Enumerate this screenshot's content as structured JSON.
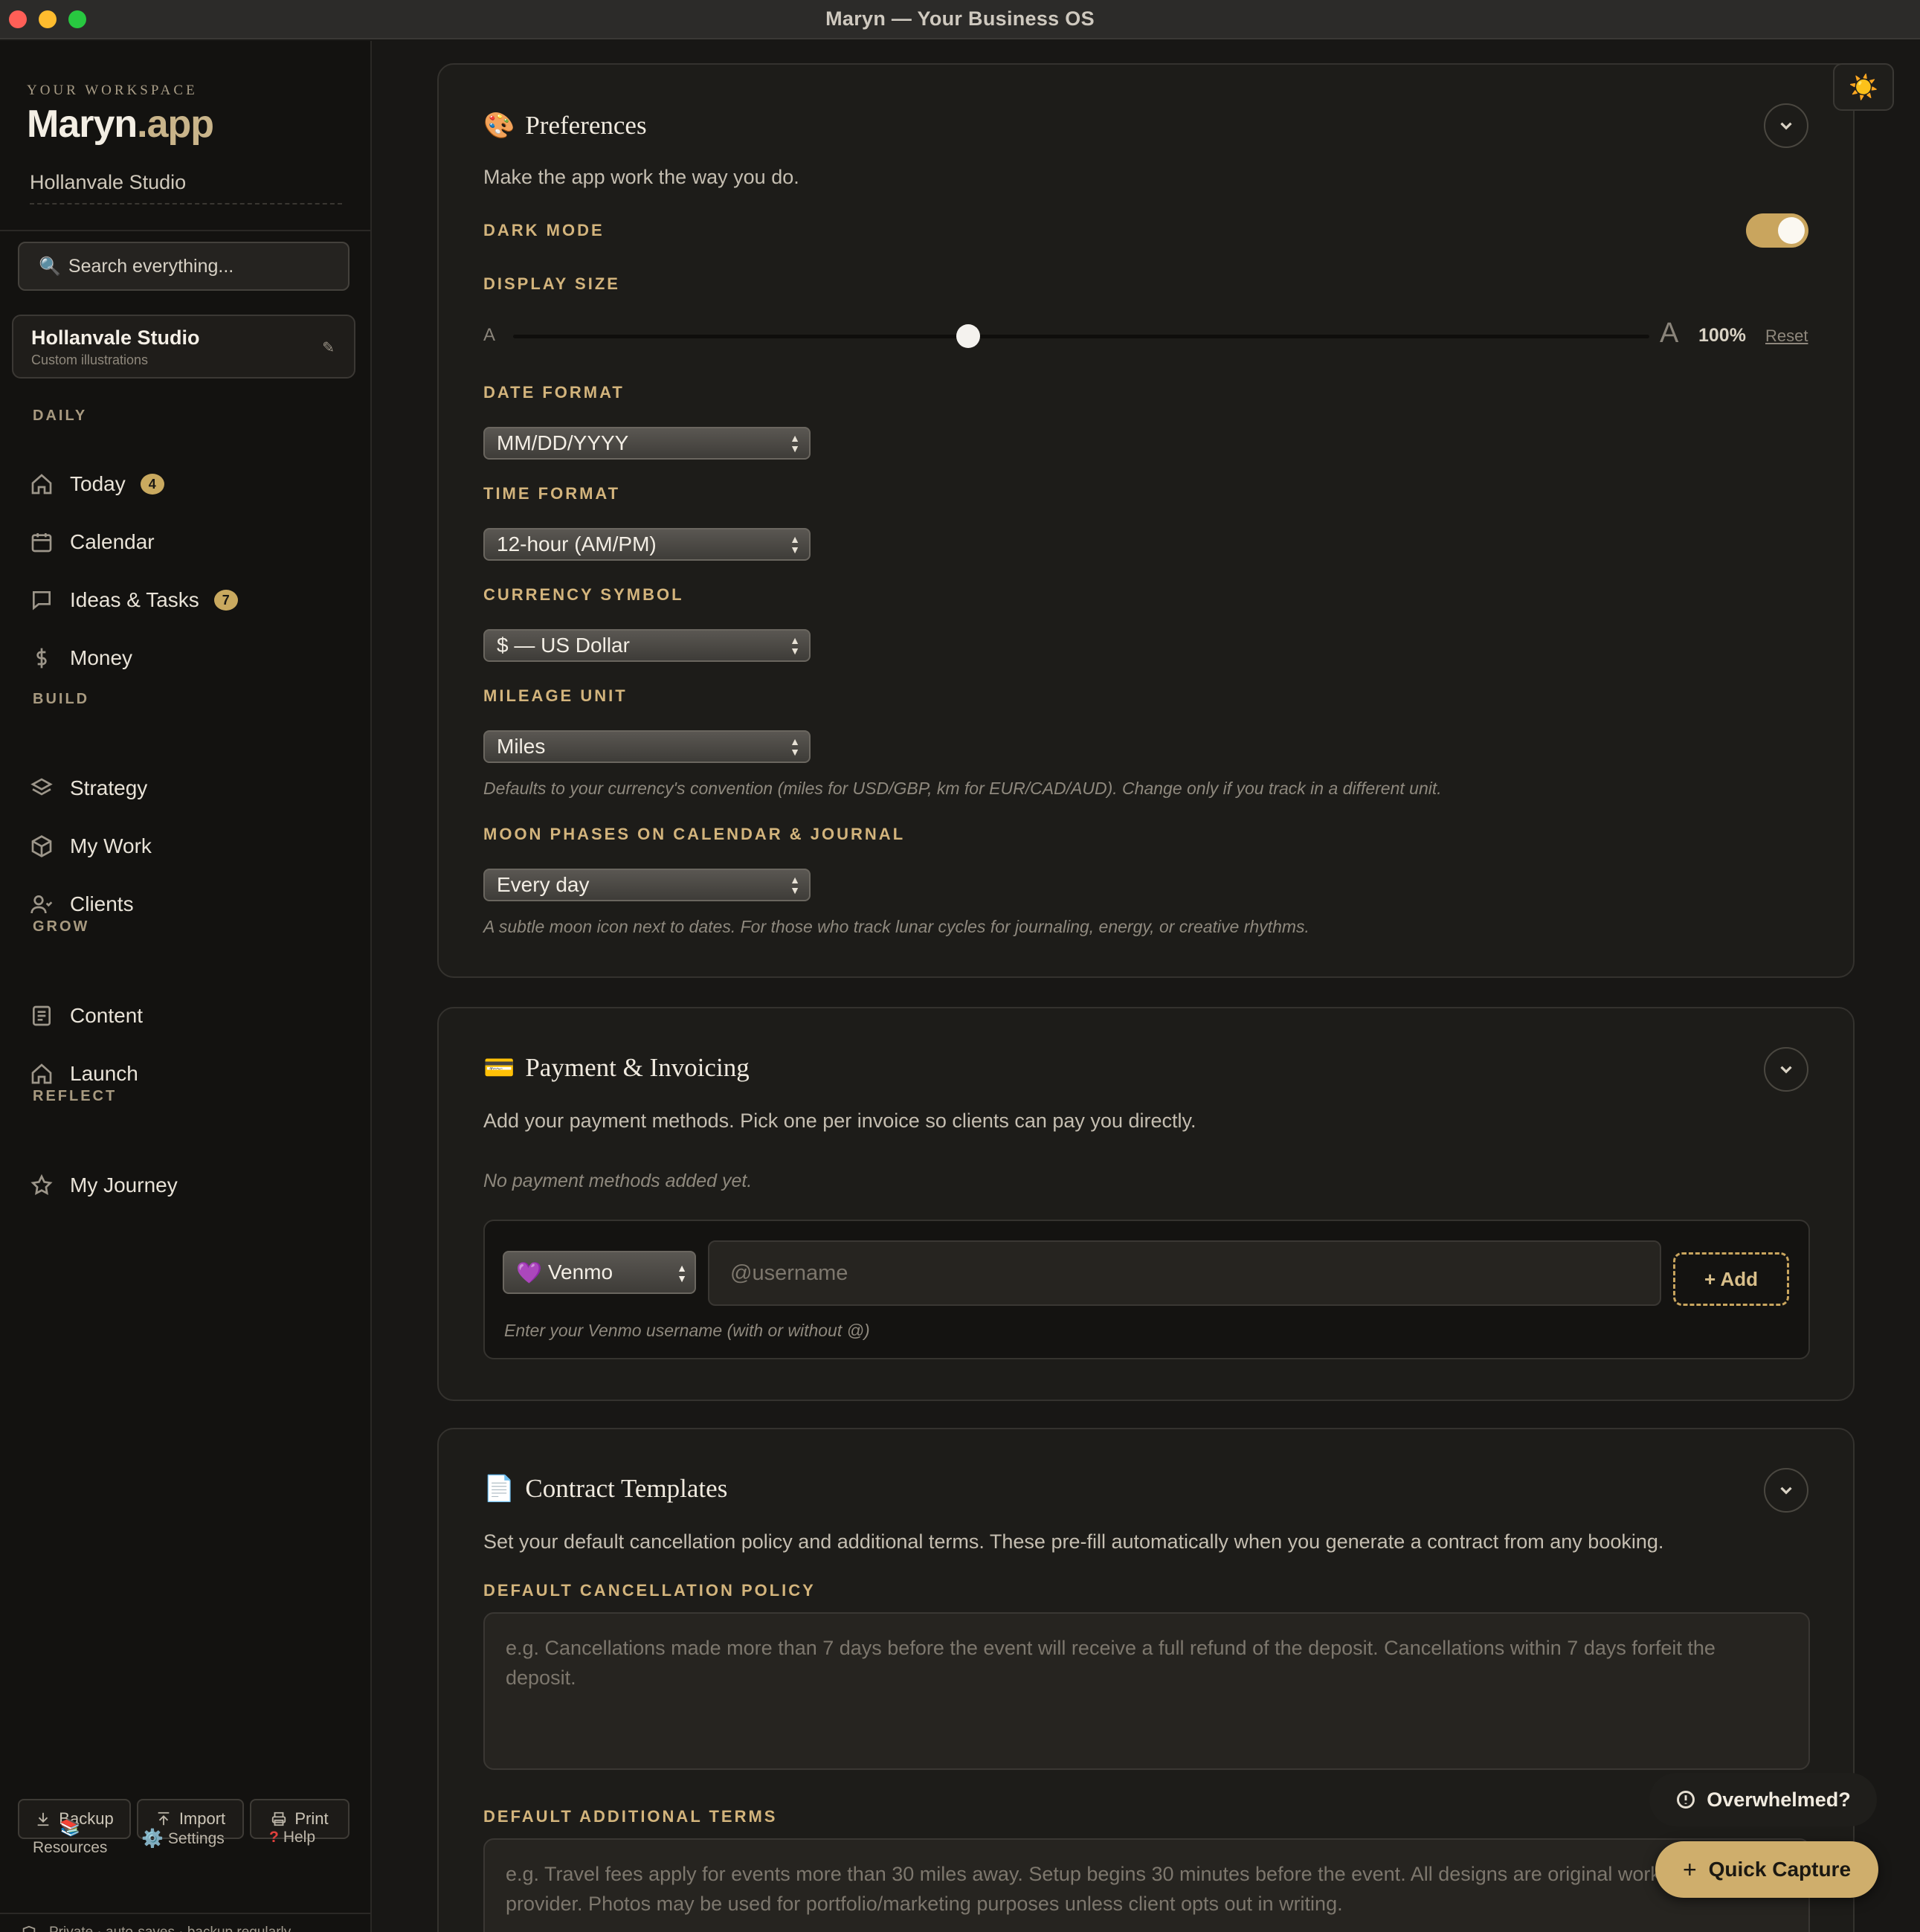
{
  "window": {
    "title": "Maryn — Your Business OS"
  },
  "sidebar": {
    "workspace_label": "YOUR WORKSPACE",
    "brand_main": "Maryn",
    "brand_suffix": ".app",
    "studio_name": "Hollanvale Studio",
    "search_placeholder": "Search everything...",
    "studio_card": {
      "name": "Hollanvale Studio",
      "subtitle": "Custom illustrations",
      "edit_glyph": "✎"
    },
    "sections": {
      "daily": "DAILY",
      "build": "BUILD",
      "grow": "GROW",
      "reflect": "REFLECT"
    },
    "items": {
      "today": {
        "label": "Today",
        "badge": "4"
      },
      "calendar": {
        "label": "Calendar"
      },
      "ideas": {
        "label": "Ideas & Tasks",
        "badge": "7"
      },
      "money": {
        "label": "Money"
      },
      "strategy": {
        "label": "Strategy"
      },
      "mywork": {
        "label": "My Work"
      },
      "clients": {
        "label": "Clients"
      },
      "content": {
        "label": "Content"
      },
      "launch": {
        "label": "Launch"
      },
      "journey": {
        "label": "My Journey"
      }
    },
    "footer": {
      "backup": "Backup",
      "import": "Import",
      "print": "Print",
      "resources": "Resources",
      "settings": "Settings",
      "help": "Help",
      "privacy": "Private · auto-saves · backup regularly"
    }
  },
  "preferences": {
    "title": "Preferences",
    "emoji": "🎨",
    "description": "Make the app work the way you do.",
    "dark_mode_label": "DARK MODE",
    "dark_mode_on": true,
    "display_size_label": "DISPLAY SIZE",
    "display_small_a": "A",
    "display_large_a": "A",
    "display_size_value": "100%",
    "display_size_fraction": 0.4,
    "reset_label": "Reset",
    "date_format_label": "DATE FORMAT",
    "date_format_value": "MM/DD/YYYY",
    "time_format_label": "TIME FORMAT",
    "time_format_value": "12-hour (AM/PM)",
    "currency_label": "CURRENCY SYMBOL",
    "currency_value": "$ — US Dollar",
    "mileage_label": "MILEAGE UNIT",
    "mileage_value": "Miles",
    "mileage_help": "Defaults to your currency's convention (miles for USD/GBP, km for EUR/CAD/AUD). Change only if you track in a different unit.",
    "moon_label": "MOON PHASES ON CALENDAR & JOURNAL",
    "moon_value": "Every day",
    "moon_help": "A subtle moon icon next to dates. For those who track lunar cycles for journaling, energy, or creative rhythms."
  },
  "payment": {
    "title": "Payment & Invoicing",
    "emoji": "💳",
    "description": "Add your payment methods. Pick one per invoice so clients can pay you directly.",
    "empty_text": "No payment methods added yet.",
    "method_emoji": "💜",
    "method_value": "Venmo",
    "username_placeholder": "@username",
    "add_label": "+ Add",
    "help": "Enter your Venmo username (with or without @)"
  },
  "contracts": {
    "title": "Contract Templates",
    "emoji": "📄",
    "description": "Set your default cancellation policy and additional terms. These pre-fill automatically when you generate a contract from any booking.",
    "cancellation_label": "DEFAULT CANCELLATION POLICY",
    "cancellation_placeholder": "e.g. Cancellations made more than 7 days before the event will receive a full refund of the deposit. Cancellations within 7 days forfeit the deposit.",
    "terms_label": "DEFAULT ADDITIONAL TERMS",
    "terms_placeholder": "e.g. Travel fees apply for events more than 30 miles away. Setup begins 30 minutes before the event. All designs are original work of the service provider. Photos may be used for portfolio/marketing purposes unless client opts out in writing."
  },
  "floating": {
    "overwhelmed": "Overwhelmed?",
    "quick_capture": "Quick Capture",
    "theme_icon": "☀️"
  }
}
